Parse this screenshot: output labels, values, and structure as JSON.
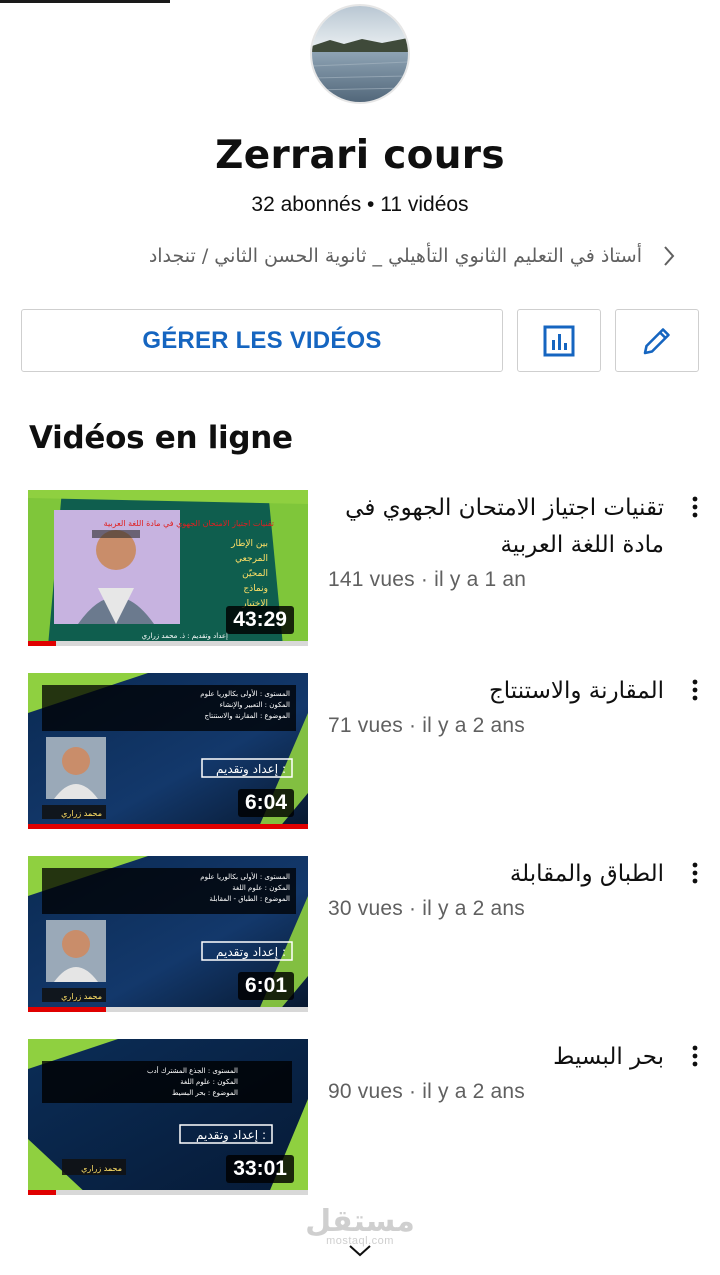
{
  "channel": {
    "name": "Zerrari cours",
    "stats": "32 abonnés • 11 vidéos",
    "description": "أستاذ في التعليم الثانوي التأهيلي _ ثانوية الحسن الثاني / تنجداد"
  },
  "actions": {
    "manage_label": "GÉRER LES VIDÉOS",
    "stats_icon": "bar-chart-icon",
    "edit_icon": "pencil-icon"
  },
  "section": {
    "title": "Vidéos en ligne"
  },
  "videos": [
    {
      "title": "تقنيات اجتياز الامتحان الجهوي في مادة اللغة العربية",
      "meta": "141 vues · il y a 1 an",
      "duration": "43:29",
      "progress": 0.1,
      "thumb_lines": [
        "تقنيات اجتياز الامتحان الجهوي في مادة اللغة العربية",
        "بين الإطار",
        "المرجعي",
        "المحيّن",
        "ونماذج",
        "الاختبار",
        "إعداد وتقديم : ذ. محمد زراري"
      ]
    },
    {
      "title": "المقارنة والاستنتاج",
      "meta": "71 vues · il y a 2 ans",
      "duration": "6:04",
      "progress": 1.0,
      "thumb_lines": [
        "المستوى : الأولى بكالوريا علوم",
        "المكون : التعبير والإنشاء",
        "الموضوع : المقارنة والاستنتاج",
        "إعداد وتقديم :",
        "محمد زراري"
      ]
    },
    {
      "title": "الطباق والمقابلة",
      "meta": "30 vues · il y a 2 ans",
      "duration": "6:01",
      "progress": 0.28,
      "thumb_lines": [
        "المستوى : الأولى بكالوريا علوم",
        "المكون : علوم اللغة",
        "الموضوع : الطباق - المقابلة",
        "إعداد وتقديم :",
        "محمد زراري"
      ]
    },
    {
      "title": "بحر البسيط",
      "meta": "90 vues · il y a 2 ans",
      "duration": "33:01",
      "progress": 0.1,
      "thumb_lines": [
        "المستوى : الجذع المشترك أدب",
        "المكون : علوم اللغة",
        "الموضوع : بحر البسيط",
        "إعداد وتقديم :",
        "محمد زراري"
      ]
    }
  ],
  "watermark": {
    "main": "مستقل",
    "sub": "mostaql.com"
  },
  "colors": {
    "accent": "#1565c0",
    "progress": "#e00000",
    "meta": "#606060"
  }
}
